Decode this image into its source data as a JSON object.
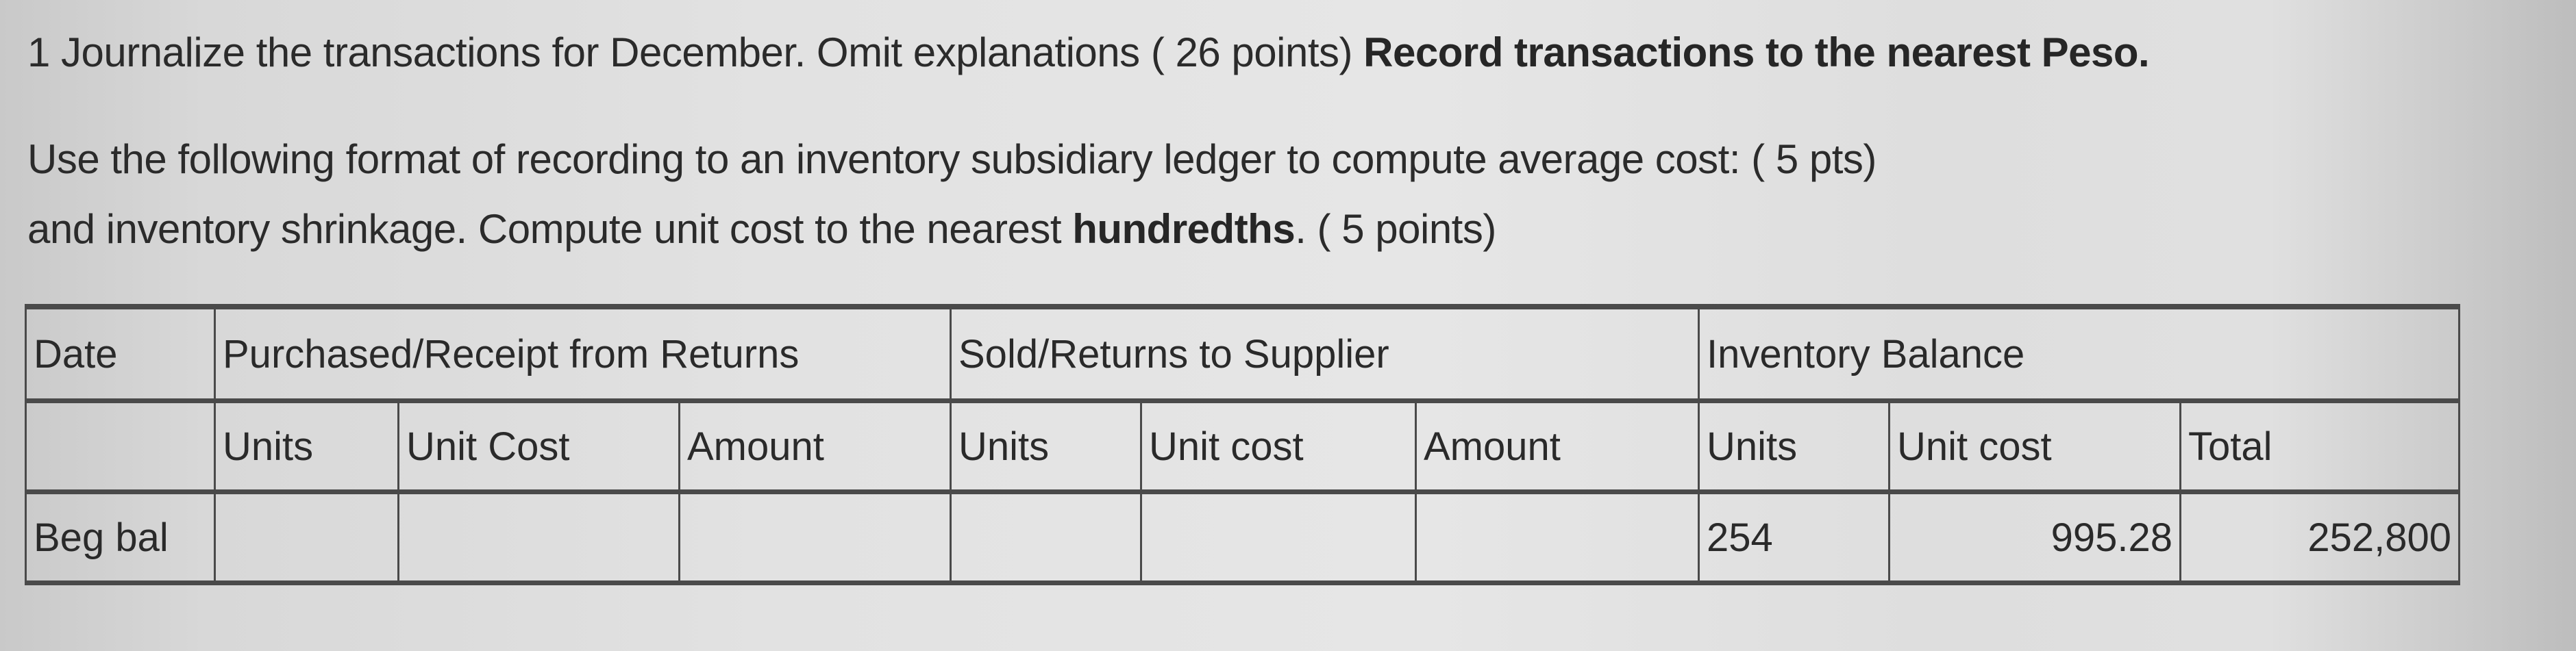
{
  "instructions": {
    "line1": {
      "normal": "1 Journalize the transactions for December. Omit explanations ( 26 points) ",
      "bold": "Record transactions to the nearest Peso."
    },
    "line2": "Use the following format of recording to an inventory subsidiary ledger to compute average cost: ( 5 pts)",
    "line3": {
      "normal_before": "and inventory shrinkage. Compute unit cost to the nearest ",
      "bold": "hundredths",
      "normal_after": ". ( 5 points)"
    }
  },
  "ledger": {
    "group_headers": {
      "date": "Date",
      "purchased": "Purchased/Receipt from Returns",
      "sold": "Sold/Returns to Supplier",
      "balance": "Inventory Balance"
    },
    "sub_headers": {
      "purchased": [
        "Units",
        "Unit Cost",
        "Amount"
      ],
      "sold": [
        "Units",
        "Unit cost",
        "Amount"
      ],
      "balance": [
        "Units",
        "Unit cost",
        "Total"
      ]
    },
    "rows": [
      {
        "date": "Beg bal",
        "purchased": [
          "",
          "",
          ""
        ],
        "sold": [
          "",
          "",
          ""
        ],
        "balance": [
          "254",
          "995.28",
          "252,800"
        ]
      }
    ]
  }
}
